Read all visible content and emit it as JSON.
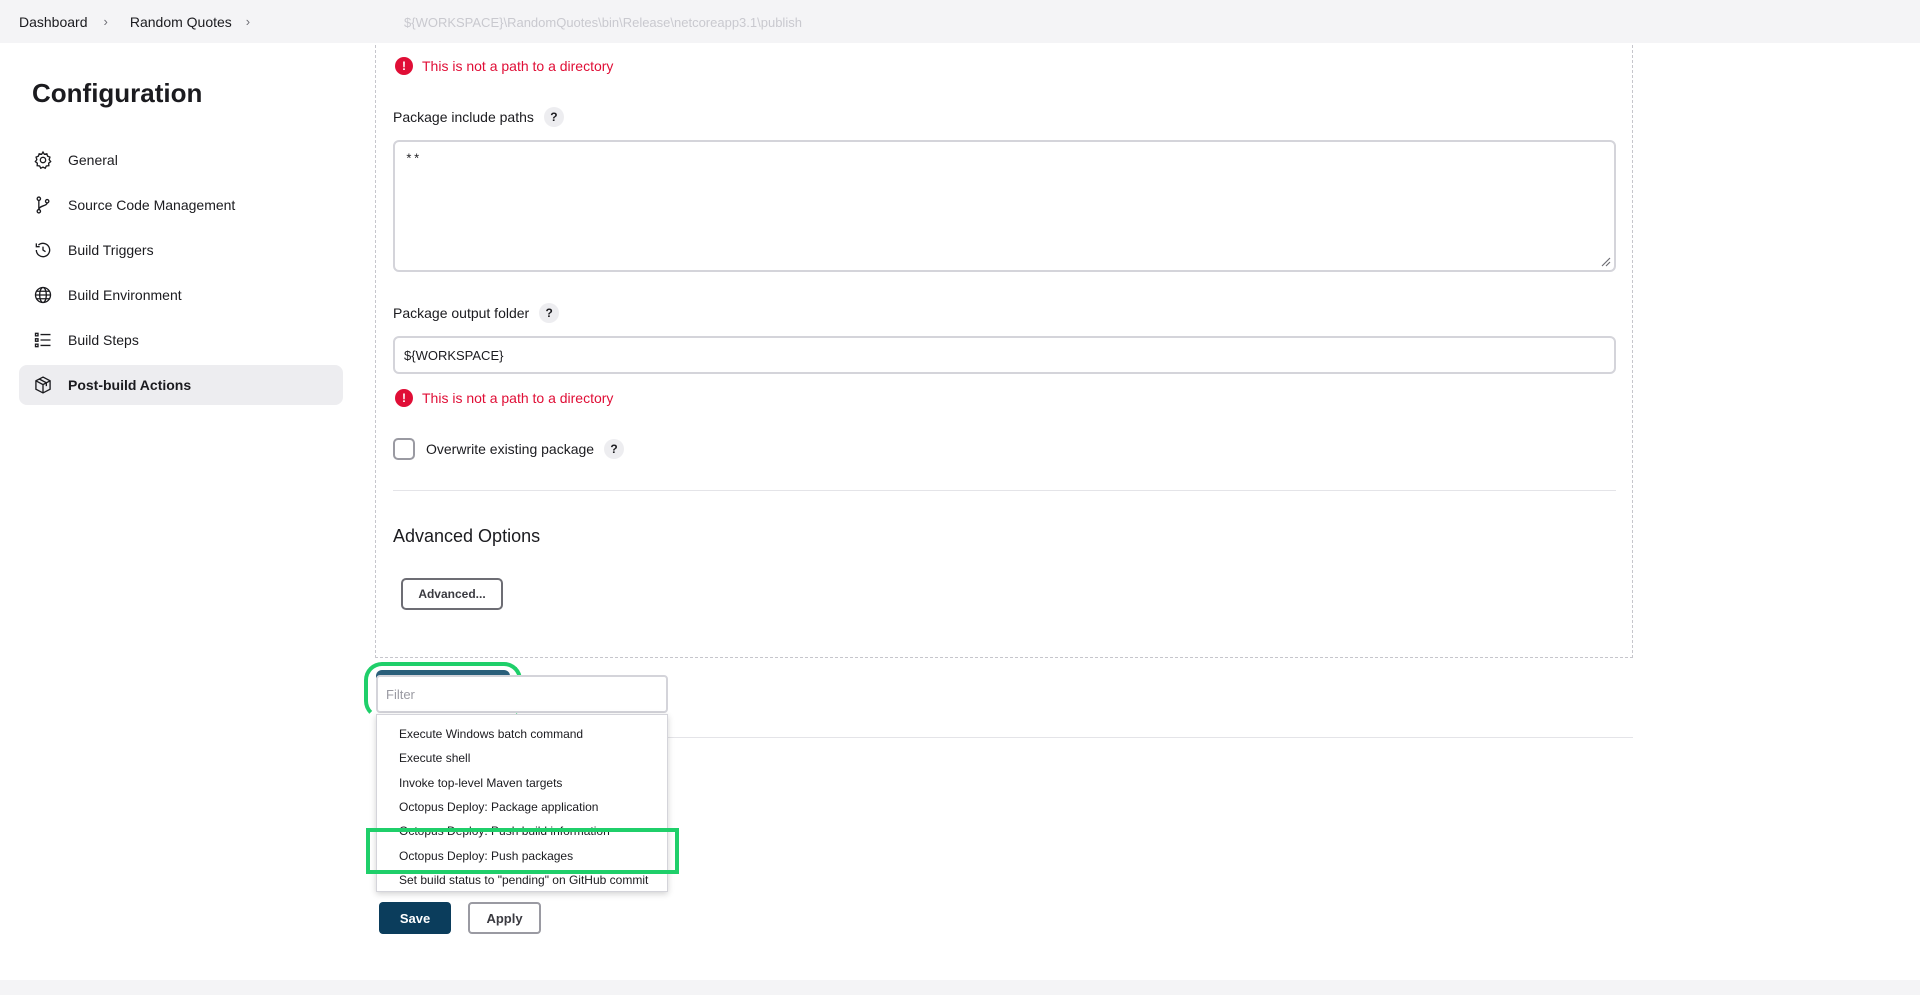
{
  "breadcrumb": {
    "items": [
      "Dashboard",
      "Random Quotes"
    ],
    "ghost_path": "${WORKSPACE}\\RandomQuotes\\bin\\Release\\netcoreapp3.1\\publish"
  },
  "sidebar": {
    "title": "Configuration",
    "items": [
      {
        "label": "General",
        "icon": "gear-icon"
      },
      {
        "label": "Source Code Management",
        "icon": "branch-icon"
      },
      {
        "label": "Build Triggers",
        "icon": "clock-icon"
      },
      {
        "label": "Build Environment",
        "icon": "globe-icon"
      },
      {
        "label": "Build Steps",
        "icon": "list-icon"
      },
      {
        "label": "Post-build Actions",
        "icon": "package-icon",
        "active": true
      }
    ]
  },
  "form": {
    "error_text": "This is not a path to a directory",
    "include_paths_label": "Package include paths",
    "include_paths_value": "**",
    "output_folder_label": "Package output folder",
    "output_folder_value": "${WORKSPACE}",
    "overwrite_label": "Overwrite existing package",
    "advanced_heading": "Advanced Options",
    "advanced_button": "Advanced...",
    "help": "?"
  },
  "dropdown": {
    "filter_placeholder": "Filter",
    "items": [
      "Execute Windows batch command",
      "Execute shell",
      "Invoke top-level Maven targets",
      "Octopus Deploy: Package application",
      "Octopus Deploy: Push build information",
      "Octopus Deploy: Push packages",
      "Set build status to \"pending\" on GitHub commit"
    ]
  },
  "actions": {
    "save": "Save",
    "apply": "Apply"
  },
  "colors": {
    "error": "#e00e36",
    "highlight": "#1fcf6a",
    "primary": "#0b3d5c"
  }
}
